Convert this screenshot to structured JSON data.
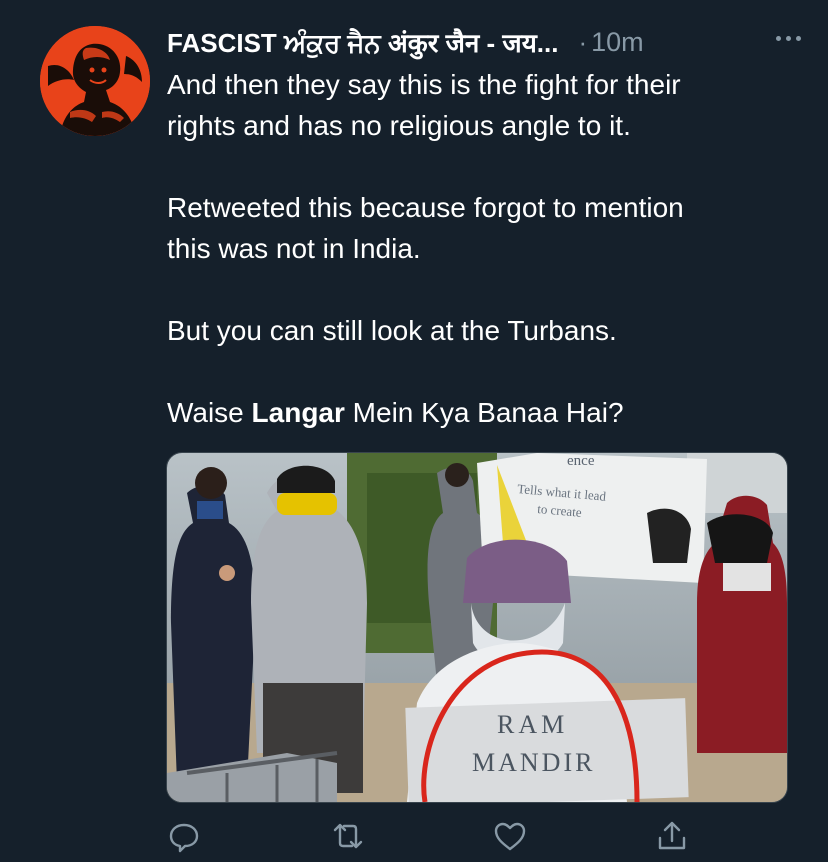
{
  "tweet": {
    "author_name": "FASCIST ਅੰਕੁਰ ਜੈਨ अंकुर जैन - जय...",
    "separator": "·",
    "time": "10m",
    "lines": [
      "And then they say this is the fight for their",
      "rights and has no religious angle to it.",
      "Retweeted this because forgot to mention",
      "this was not in India.",
      "But you can still look at the Turbans."
    ],
    "last_line": {
      "prefix": "Waise ",
      "bold": "Langar",
      "suffix": " Mein Kya Banaa Hai?"
    }
  },
  "media": {
    "sign_line1": "RAM",
    "sign_line2": "MANDIR",
    "placard_line1": "ence",
    "placard_line2": "Tells what it lead",
    "placard_line3": "to create"
  },
  "actions": [
    "reply-icon",
    "retweet-icon",
    "like-icon",
    "share-icon"
  ],
  "colors": {
    "background": "#15202b",
    "secondary_text": "#8899a6",
    "avatar_bg": "#e8431a",
    "annotation_circle": "#d9261c"
  }
}
